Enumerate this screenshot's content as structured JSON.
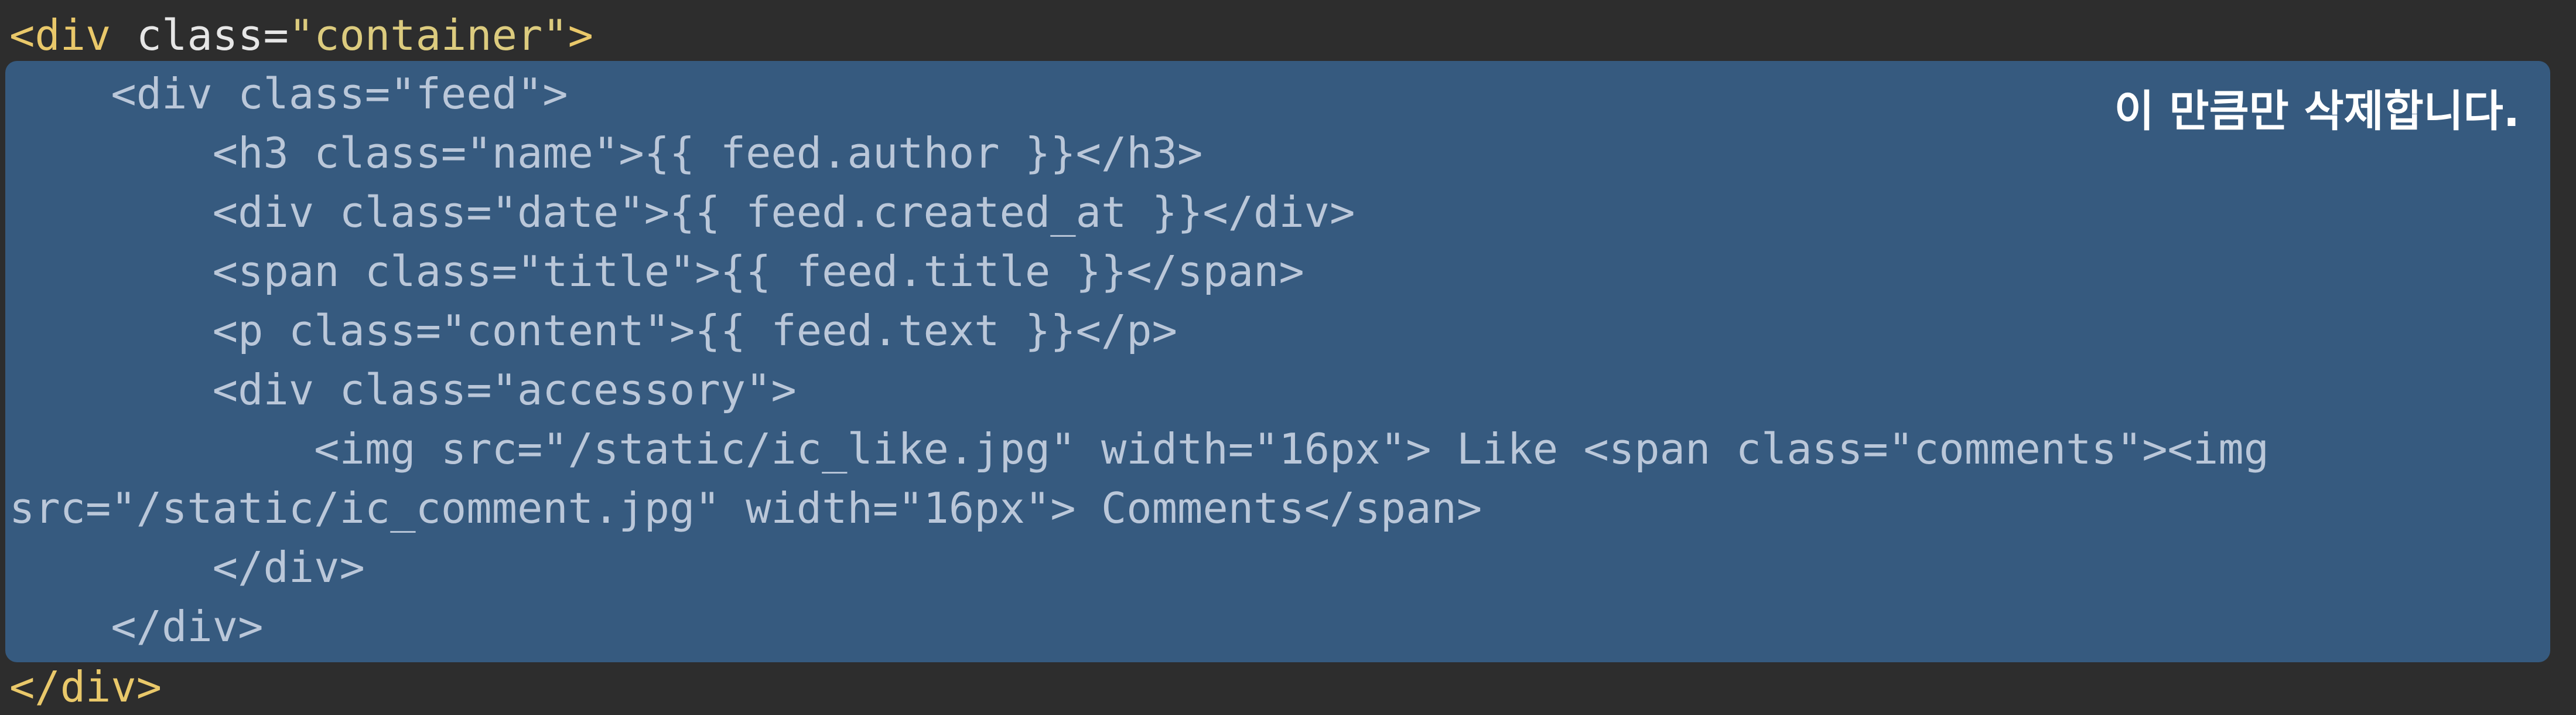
{
  "code": {
    "open": {
      "tag": "<div ",
      "attr": "class=",
      "value": "\"container\"",
      "end": ">"
    },
    "selected_lines": [
      "    <div class=\"feed\">",
      "        <h3 class=\"name\">{{ feed.author }}</h3>",
      "        <div class=\"date\">{{ feed.created_at }}</div>",
      "        <span class=\"title\">{{ feed.title }}</span>",
      "        <p class=\"content\">{{ feed.text }}</p>",
      "        <div class=\"accessory\">",
      "            <img src=\"/static/ic_like.jpg\" width=\"16px\"> Like <span class=\"comments\"><img",
      "src=\"/static/ic_comment.jpg\" width=\"16px\"> Comments</span>",
      "        </div>",
      "    </div>"
    ],
    "close": "</div>"
  },
  "annotation": "이 만큼만 삭제합니다.",
  "colors": {
    "background": "#2d2d2d",
    "selection": "#365a7f",
    "tag": "#e9c86a",
    "selected_text": "#bac7d9",
    "string": "#a8c6b4",
    "annotation": "#ffffff"
  }
}
